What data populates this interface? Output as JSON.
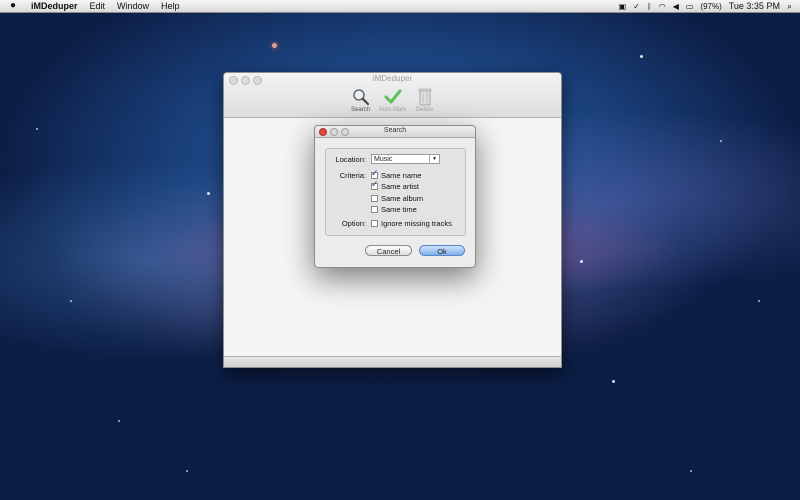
{
  "menubar": {
    "app_name": "iMDeduper",
    "items": [
      "Edit",
      "Window",
      "Help"
    ],
    "battery": "(97%)",
    "clock": "Tue 3:35 PM"
  },
  "window": {
    "title": "iMDeduper",
    "toolbar": [
      {
        "label": "Search",
        "icon": "magnifier-icon",
        "enabled": true
      },
      {
        "label": "Auto Mark",
        "icon": "checkmark-icon",
        "enabled": false
      },
      {
        "label": "Delete",
        "icon": "trash-icon",
        "enabled": false
      }
    ]
  },
  "dialog": {
    "title": "Search",
    "location_label": "Location:",
    "location_value": "Music",
    "criteria_label": "Criteria:",
    "criteria": [
      {
        "label": "Same name",
        "checked": true
      },
      {
        "label": "Same artist",
        "checked": true
      },
      {
        "label": "Same album",
        "checked": false
      },
      {
        "label": "Same time",
        "checked": false
      }
    ],
    "option_label": "Option:",
    "option": {
      "label": "Ignore missing tracks",
      "checked": false
    },
    "cancel_label": "Cancel",
    "ok_label": "Ok"
  }
}
